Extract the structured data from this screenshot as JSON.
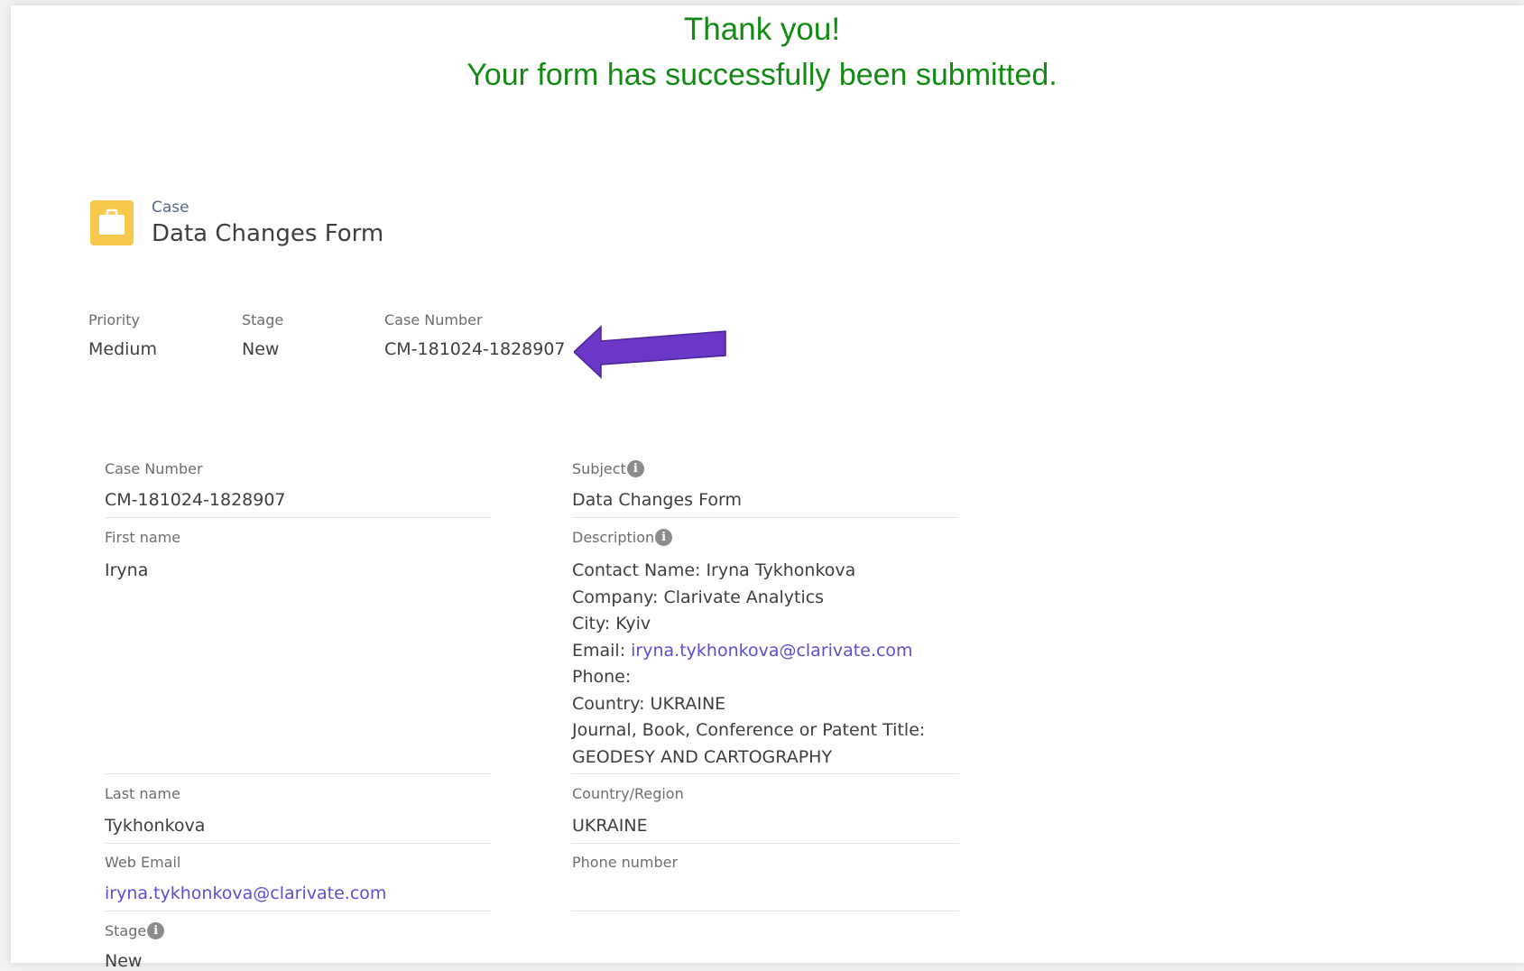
{
  "banner": {
    "line1": "Thank you!",
    "line2": "Your form has successfully been submitted."
  },
  "header": {
    "object_type": "Case",
    "title": "Data Changes Form",
    "icon": "briefcase-icon",
    "icon_color": "#f6c94d"
  },
  "highlights": {
    "priority_label": "Priority",
    "priority_value": "Medium",
    "stage_label": "Stage",
    "stage_value": "New",
    "case_number_label": "Case Number",
    "case_number_value": "CM-181024-1828907"
  },
  "annotation": {
    "icon": "arrow-left-icon",
    "color": "#6a37c6"
  },
  "details": {
    "case_number_label": "Case Number",
    "case_number_value": "CM-181024-1828907",
    "first_name_label": "First name",
    "first_name_value": "Iryna",
    "last_name_label": "Last name",
    "last_name_value": "Tykhonkova",
    "web_email_label": "Web Email",
    "web_email_value": "iryna.tykhonkova@clarivate.com",
    "stage_label": "Stage",
    "stage_value": "New",
    "subject_label": "Subject",
    "subject_value": "Data Changes Form",
    "description_label": "Description",
    "description": {
      "contact": "Contact Name: Iryna Tykhonkova",
      "company": "Company: Clarivate Analytics",
      "city": "City: Kyiv",
      "email_prefix": "Email: ",
      "email_link": "iryna.tykhonkova@clarivate.com",
      "phone": "Phone:",
      "country": "Country: UKRAINE",
      "title_label": "Journal, Book, Conference or Patent Title:",
      "title_value": "GEODESY AND CARTOGRAPHY"
    },
    "country_label": "Country/Region",
    "country_value": "UKRAINE",
    "phone_label": "Phone number",
    "phone_value": ""
  }
}
